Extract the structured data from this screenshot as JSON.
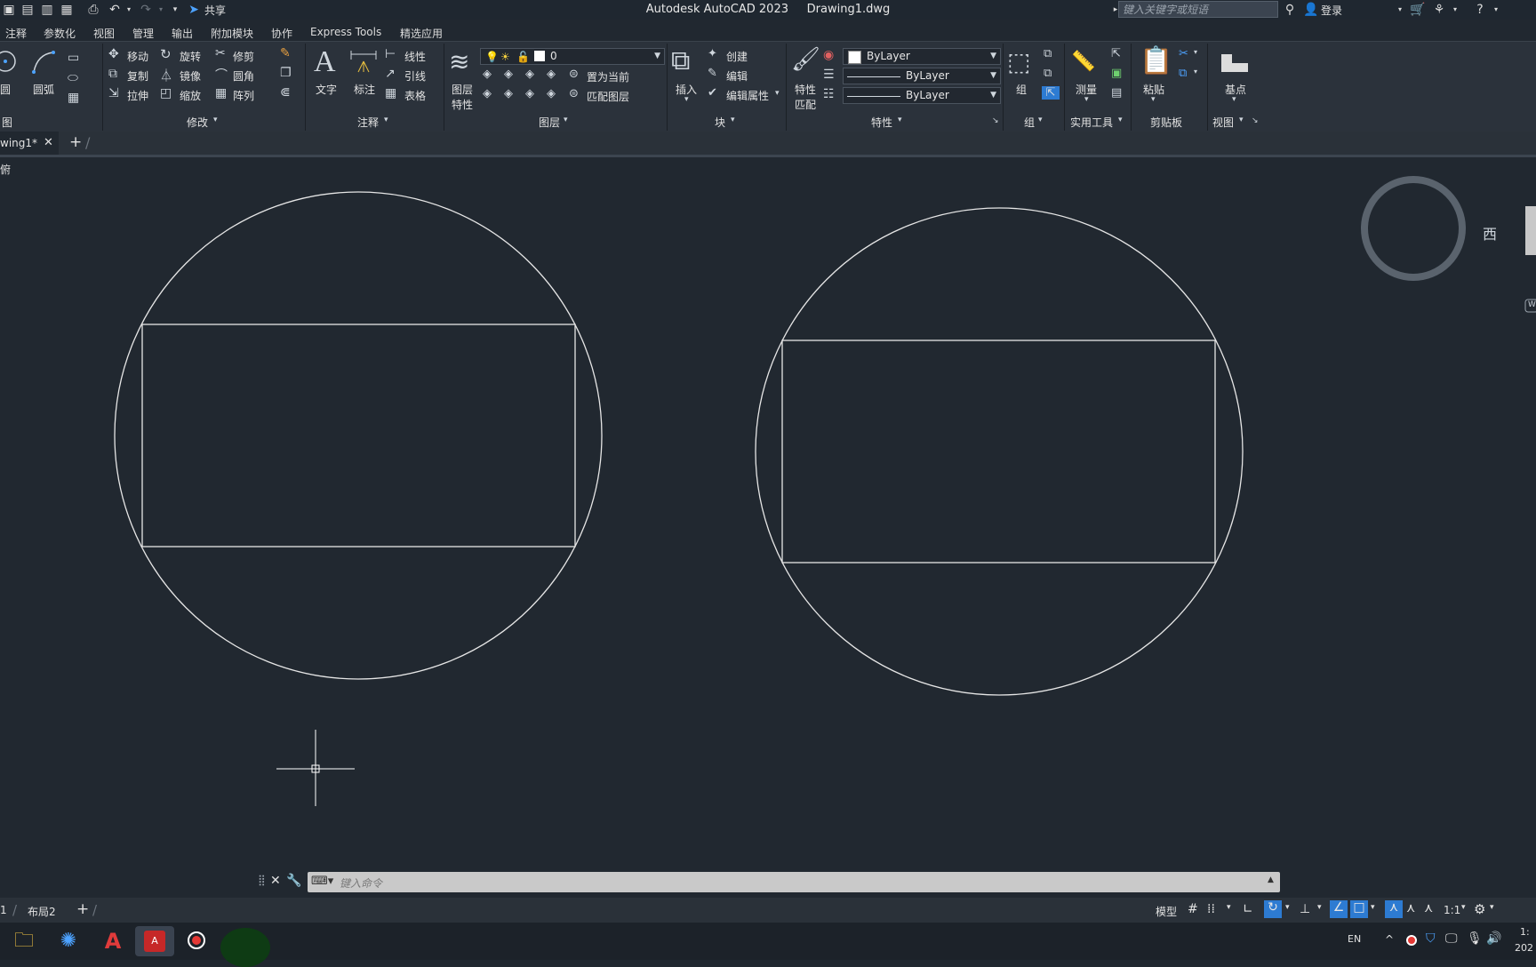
{
  "titlebar": {
    "app_title": "Autodesk AutoCAD 2023",
    "doc_title": "Drawing1.dwg",
    "share_label": "共享",
    "search_placeholder": "键入关键字或短语",
    "login_label": "登录"
  },
  "menu_tabs": [
    "注释",
    "参数化",
    "视图",
    "管理",
    "输出",
    "附加模块",
    "协作",
    "Express Tools",
    "精选应用"
  ],
  "ribbon": {
    "draw": {
      "circle": "圆",
      "arc": "圆弧",
      "title": "图"
    },
    "modify": {
      "move": "移动",
      "rotate": "旋转",
      "trim": "修剪",
      "copy": "复制",
      "mirror": "镜像",
      "fillet": "圆角",
      "stretch": "拉伸",
      "scale": "缩放",
      "array": "阵列",
      "title": "修改"
    },
    "annotation": {
      "text": "文字",
      "dim": "标注",
      "linear": "线性",
      "leader": "引线",
      "table": "表格",
      "title": "注释"
    },
    "layers": {
      "props_line1": "图层",
      "props_line2": "特性",
      "current_layer": "0",
      "set_current": "置为当前",
      "match": "匹配图层",
      "title": "图层"
    },
    "block": {
      "insert": "插入",
      "create": "创建",
      "edit": "编辑",
      "edit_attr": "编辑属性",
      "title": "块"
    },
    "properties": {
      "match_line1": "特性",
      "match_line2": "匹配",
      "color": "ByLayer",
      "linetype": "ByLayer",
      "lineweight": "ByLayer",
      "title": "特性"
    },
    "groups": {
      "group": "组",
      "title": "组"
    },
    "utilities": {
      "measure": "测量",
      "title": "实用工具"
    },
    "clipboard": {
      "paste": "粘贴",
      "title": "剪贴板"
    },
    "view": {
      "base": "基点",
      "title": "视图"
    }
  },
  "file_tabs": {
    "active": "wing1*"
  },
  "viewport_label": "俯",
  "viewcube": {
    "west": "西",
    "wcs": "W"
  },
  "command": {
    "placeholder": "键入命令"
  },
  "layout_tabs": [
    "1",
    "布局2"
  ],
  "status": {
    "model": "模型",
    "scale": "1:1"
  },
  "taskbar": {
    "lang": "EN",
    "clock_top": "1:",
    "clock_bottom": "202"
  },
  "colors": {
    "background": "#212830",
    "ribbon": "#2b323b",
    "geometry": "#e6e6e6",
    "accent": "#2d7bd2"
  }
}
